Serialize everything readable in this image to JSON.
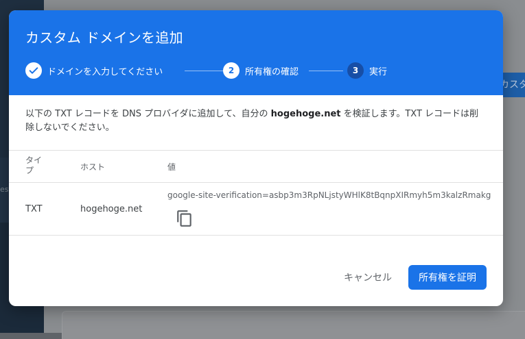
{
  "background": {
    "nav_fragment": "est",
    "button_fragment": "カスタ"
  },
  "dialog": {
    "title": "カスタム ドメインを追加",
    "steps": [
      {
        "number": "",
        "label": "ドメインを入力してください",
        "state": "done"
      },
      {
        "number": "2",
        "label": "所有権の確認",
        "state": "active"
      },
      {
        "number": "3",
        "label": "実行",
        "state": "pending"
      }
    ],
    "description": {
      "before": "以下の TXT レコードを DNS プロバイダに追加して、自分の ",
      "domain": "hogehoge.net",
      "after": " を検証します。TXT レコードは削除しないでください。"
    },
    "table": {
      "headers": {
        "type": "タイプ",
        "host": "ホスト",
        "value": "値"
      },
      "row": {
        "type": "TXT",
        "host": "hogehoge.net",
        "value": "google-site-verification=asbp3m3RpNLjstyWHlK8tBqnpXIRmyh5m3kalzRmakg"
      },
      "copy_icon": "copy-icon"
    },
    "actions": {
      "cancel_label": "キャンセル",
      "confirm_label": "所有権を証明"
    }
  },
  "colors": {
    "accent": "#1a73e8",
    "step_pending": "#174ea6",
    "text_secondary": "#5f6368"
  }
}
